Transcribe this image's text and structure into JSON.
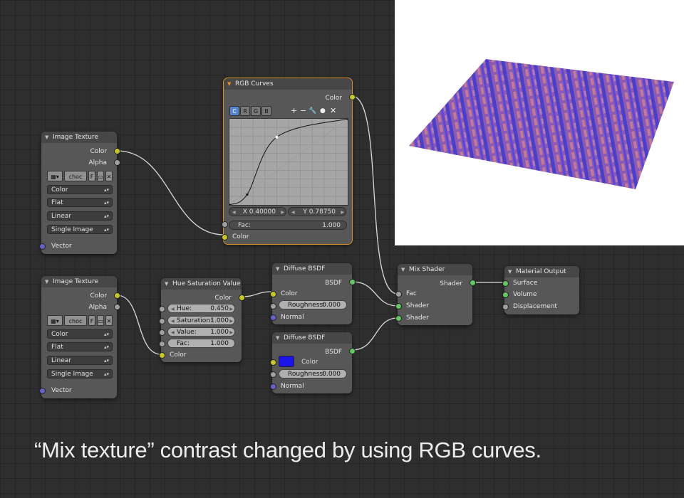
{
  "image_texture_1": {
    "title": "Image Texture",
    "outputs": [
      "Color",
      "Alpha"
    ],
    "image_name": "choc",
    "fake_user": "F",
    "color_space": "Color",
    "projection": "Flat",
    "interpolation": "Linear",
    "source": "Single Image",
    "input": "Vector"
  },
  "image_texture_2": {
    "title": "Image Texture",
    "outputs": [
      "Color",
      "Alpha"
    ],
    "image_name": "choc",
    "fake_user": "F",
    "color_space": "Color",
    "projection": "Flat",
    "interpolation": "Linear",
    "source": "Single Image",
    "input": "Vector"
  },
  "rgb_curves": {
    "title": "RGB Curves",
    "output": "Color",
    "channels": [
      "C",
      "R",
      "G",
      "B"
    ],
    "active_channel": "C",
    "tools": [
      "+",
      "−",
      "🔧",
      "●",
      "✕"
    ],
    "x_field": "X 0.40000",
    "y_field": "Y 0.78750",
    "fac_label": "Fac:",
    "fac_value": "1.000",
    "input": "Color",
    "curve_points": [
      [
        0.0,
        0.0
      ],
      [
        0.15,
        0.12
      ],
      [
        0.4,
        0.7875
      ],
      [
        1.0,
        1.0
      ]
    ]
  },
  "hsv": {
    "title": "Hue Saturation Value",
    "output": "Color",
    "hue_label": "Hue:",
    "hue_value": "0.450",
    "sat_label": "Saturation:",
    "sat_value": "1.000",
    "val_label": "Value:",
    "val_value": "1.000",
    "fac_label": "Fac:",
    "fac_value": "1.000",
    "input": "Color"
  },
  "diffuse_1": {
    "title": "Diffuse BSDF",
    "output": "BSDF",
    "color_label": "Color",
    "roughness_label": "Roughness:",
    "roughness_value": "0.000",
    "normal_label": "Normal"
  },
  "diffuse_2": {
    "title": "Diffuse BSDF",
    "output": "BSDF",
    "color_label": "Color",
    "color_swatch": "#1a14e6",
    "roughness_label": "Roughness:",
    "roughness_value": "0.000",
    "normal_label": "Normal"
  },
  "mix_shader": {
    "title": "Mix Shader",
    "output": "Shader",
    "inputs": [
      "Fac",
      "Shader",
      "Shader"
    ]
  },
  "material_output": {
    "title": "Material Output",
    "inputs": [
      "Surface",
      "Volume",
      "Displacement"
    ]
  },
  "caption": "“Mix texture” contrast changed by using RGB curves."
}
